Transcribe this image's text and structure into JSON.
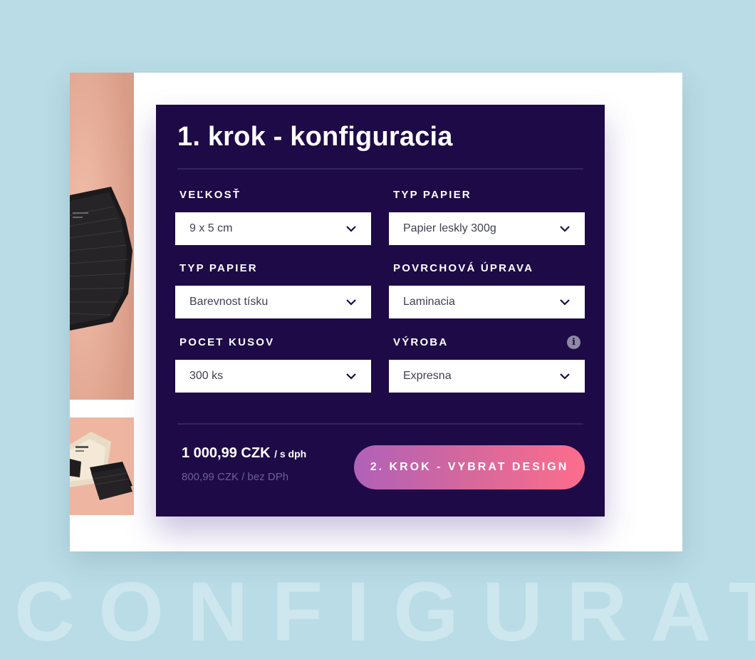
{
  "panel": {
    "title": "1. krok - konfiguracia"
  },
  "fields": [
    {
      "label": "VEĽKOSŤ",
      "value": "9 x 5 cm"
    },
    {
      "label": "TYP  PAPIER",
      "value": "Papier leskly 300g"
    },
    {
      "label": "TYP  PAPIER",
      "value": "Barevnost tísku"
    },
    {
      "label": "POVRCHOVÁ ÚPRAVA",
      "value": "Laminacia"
    },
    {
      "label": "POCET KUSOV",
      "value": "300 ks"
    },
    {
      "label": "VÝROBA",
      "value": "Expresna"
    }
  ],
  "info_icon": {
    "glyph": "i",
    "icon": "info-icon"
  },
  "price": {
    "main": "1 000,99 CZK",
    "main_suffix": "/ s dph",
    "sub": "800,99 CZK / bez DPh"
  },
  "cta": {
    "label": "2. KROK - VYBRAT DESIGN"
  },
  "watermark": "CONFIGURATION",
  "colors": {
    "page_background": "#b9dce6",
    "panel_background": "#1d0a47",
    "cta_gradient_start": "#b061b8",
    "cta_gradient_end": "#fd6d8c"
  }
}
